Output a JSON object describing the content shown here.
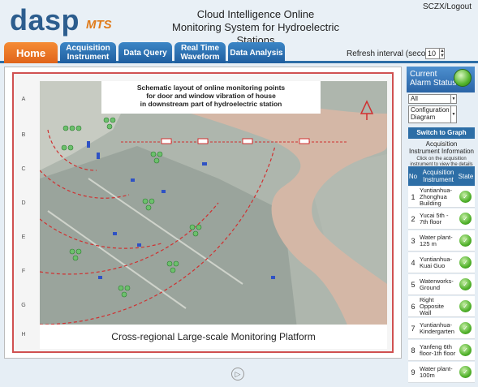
{
  "header": {
    "logo_main": "dasp",
    "logo_sub": "MTS",
    "title_line1": "Cloud Intelligence Online",
    "title_line2": "Monitoring System for Hydroelectric Stations",
    "logout": "SCZX/Logout"
  },
  "nav": {
    "home": "Home",
    "acquisition": "Acquisition Instrument",
    "data_query": "Data Query",
    "realtime": "Real Time Waveform",
    "analysis": "Data Analysis",
    "refresh_label": "Refresh interval (seconds)",
    "refresh_value": "10"
  },
  "map": {
    "title_line1": "Schematic layout of online monitoring points",
    "title_line2": "for door and window vibration of house",
    "title_line3": "in downstream part of hydroelectric station",
    "footer": "Cross-regional Large-scale Monitoring Platform",
    "row_labels": [
      "A",
      "B",
      "C",
      "D",
      "E",
      "F",
      "G",
      "H"
    ]
  },
  "sidebar": {
    "alarm_line1": "Current",
    "alarm_line2": "Alarm Status",
    "filter_value": "All",
    "config_line1": "Configuration",
    "config_line2": "Diagram",
    "switch": "Switch to Graph Menu",
    "info_line1": "Acquisition",
    "info_line2": "Instrument Information",
    "note_line1": "Click on the acquisition",
    "note_line2": "instrument to view the details",
    "col_no": "No",
    "col_instrument": "Acquisition Instrument",
    "col_state": "State",
    "rows": [
      {
        "no": "1",
        "name": "Yuntianhua-Zhonghua Building"
      },
      {
        "no": "2",
        "name": "Yucai 5th - 7th floor"
      },
      {
        "no": "3",
        "name": "Water plant-125 m"
      },
      {
        "no": "4",
        "name": "Yuntianhua-Kuai Guo"
      },
      {
        "no": "5",
        "name": "Waterworks-Ground"
      },
      {
        "no": "6",
        "name": "Right Opposite Wall"
      },
      {
        "no": "7",
        "name": "Yuntianhua-Kindergarten"
      },
      {
        "no": "8",
        "name": "Yanfeng 6th floor-1th floor"
      },
      {
        "no": "9",
        "name": "Water plant-100m"
      }
    ]
  },
  "colors": {
    "nav_blue": "#2d6ea6",
    "home_orange": "#e0641a",
    "status_ok": "#52b22c",
    "zone_red": "#d03030"
  }
}
